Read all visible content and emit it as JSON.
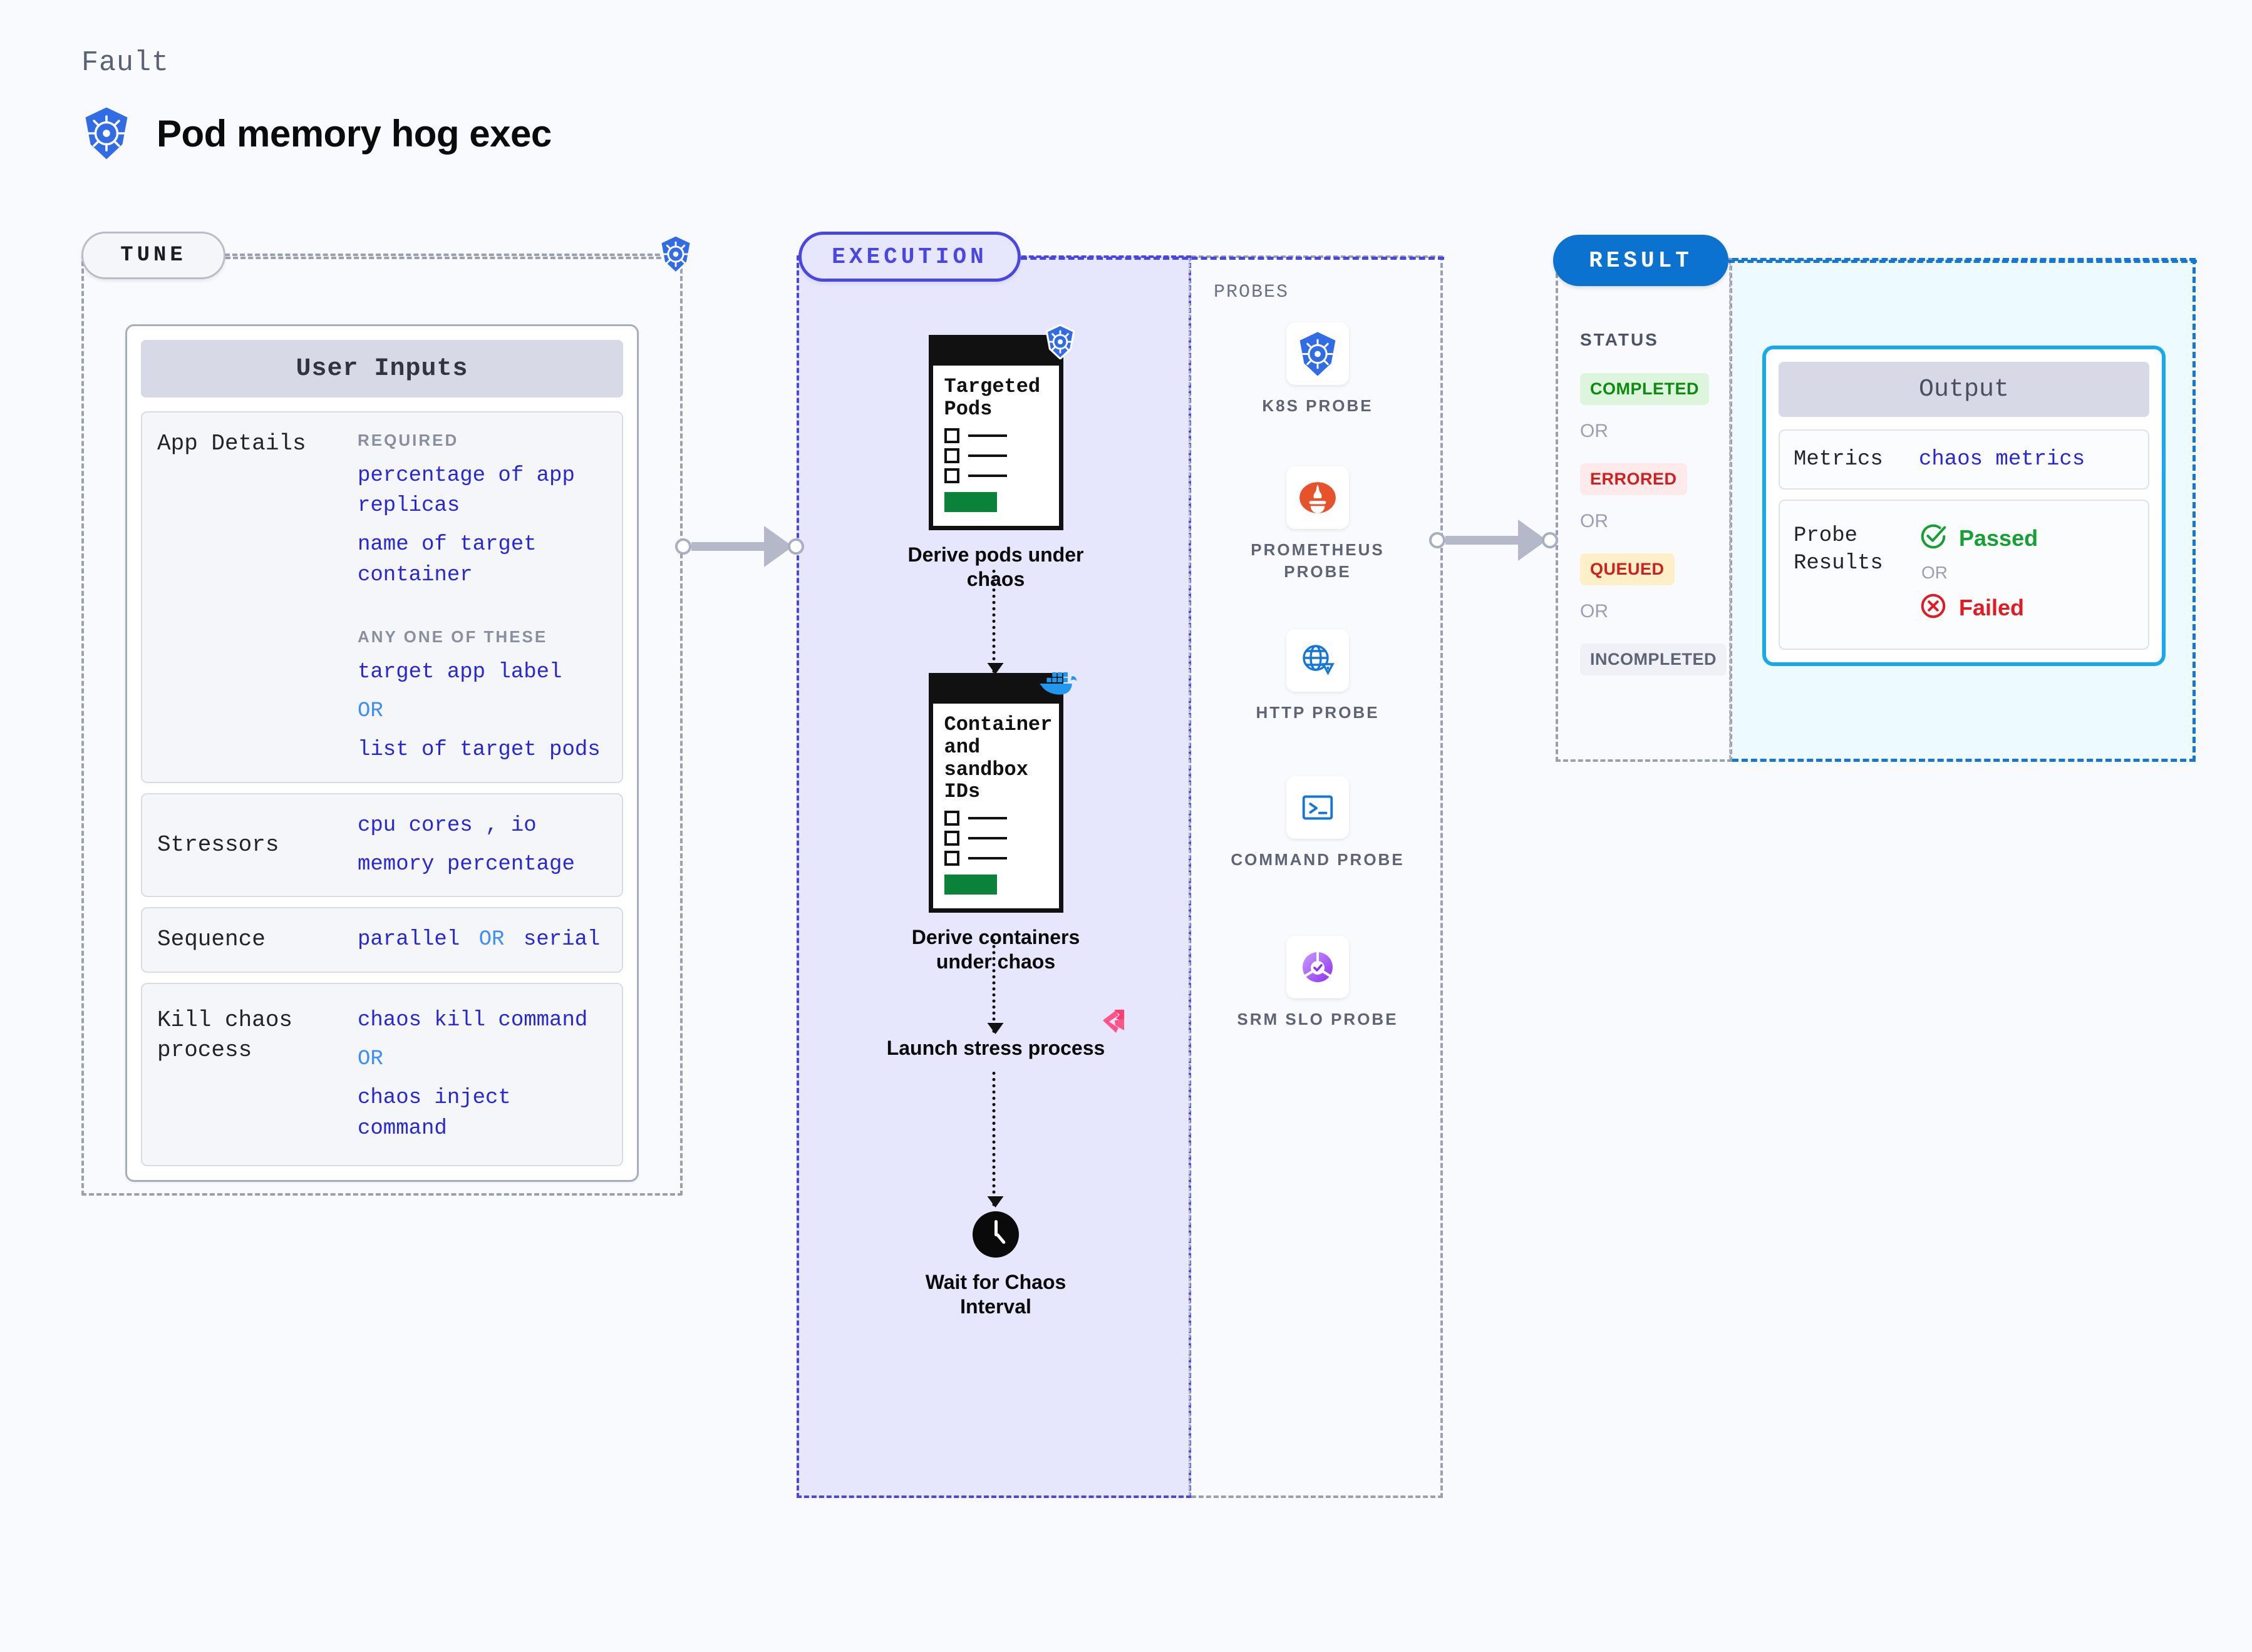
{
  "header": {
    "eyebrow": "Fault",
    "title": "Pod memory hog exec",
    "icon": "kubernetes-icon"
  },
  "stages": {
    "tune": {
      "label": "TUNE"
    },
    "execution": {
      "label": "EXECUTION"
    },
    "result": {
      "label": "RESULT"
    }
  },
  "tune": {
    "card_title": "User Inputs",
    "rows": [
      {
        "label": "App Details",
        "required_heading": "REQUIRED",
        "required_values": [
          "percentage of app replicas",
          "name of target container"
        ],
        "anyone_heading": "ANY ONE OF THESE",
        "anyone_values": [
          "target app label",
          "list of target pods"
        ],
        "or": "OR"
      },
      {
        "label": "Stressors",
        "value_line1": "cpu cores  , io",
        "value_line2": "memory percentage"
      },
      {
        "label": "Sequence",
        "value_a": "parallel",
        "or": "OR",
        "value_b": "serial"
      },
      {
        "label": "Kill chaos process",
        "value_a": "chaos kill command",
        "or": "OR",
        "value_b": "chaos inject command"
      }
    ]
  },
  "execution": {
    "steps": [
      {
        "card_title": "Targeted Pods",
        "icon": "kubernetes-icon",
        "label": "Derive pods under chaos"
      },
      {
        "card_title": "Container and sandbox IDs",
        "icon": "docker-icon",
        "label": "Derive containers under chaos"
      },
      {
        "icon": "litmus-icon",
        "label": "Launch stress process"
      },
      {
        "icon": "clock-icon",
        "label": "Wait for Chaos Interval"
      }
    ]
  },
  "probes": {
    "title": "PROBES",
    "items": [
      {
        "label": "K8S PROBE",
        "icon": "kubernetes-icon"
      },
      {
        "label": "PROMETHEUS PROBE",
        "icon": "prometheus-icon"
      },
      {
        "label": "HTTP PROBE",
        "icon": "globe-warning-icon"
      },
      {
        "label": "COMMAND PROBE",
        "icon": "terminal-icon"
      },
      {
        "label": "SRM SLO PROBE",
        "icon": "srm-slo-icon"
      }
    ]
  },
  "result": {
    "status_title": "STATUS",
    "or": "OR",
    "badges": [
      {
        "label": "COMPLETED",
        "bg": "#ddf5dd",
        "fg": "#0f8a10"
      },
      {
        "label": "ERRORED",
        "bg": "#fdeaea",
        "fg": "#cf2020"
      },
      {
        "label": "QUEUED",
        "bg": "#fdf0c9",
        "fg": "#cf2020"
      },
      {
        "label": "INCOMPLETED",
        "bg": "#f0f1f6",
        "fg": "#5e6476"
      }
    ]
  },
  "output": {
    "card_title": "Output",
    "metrics_label": "Metrics",
    "metrics_value": "chaos metrics",
    "probe_results_label": "Probe Results",
    "passed_label": "Passed",
    "failed_label": "Failed",
    "or": "OR"
  },
  "colors": {
    "accent_blue": "#2727d6",
    "execution_bg": "#e6e6fd",
    "execution_border": "#4a46e0",
    "result_border": "#1776d1",
    "output_bg": "#edfaff",
    "output_card_border": "#19a9e8",
    "passed_green": "#16a034",
    "failed_red": "#e01b24"
  }
}
